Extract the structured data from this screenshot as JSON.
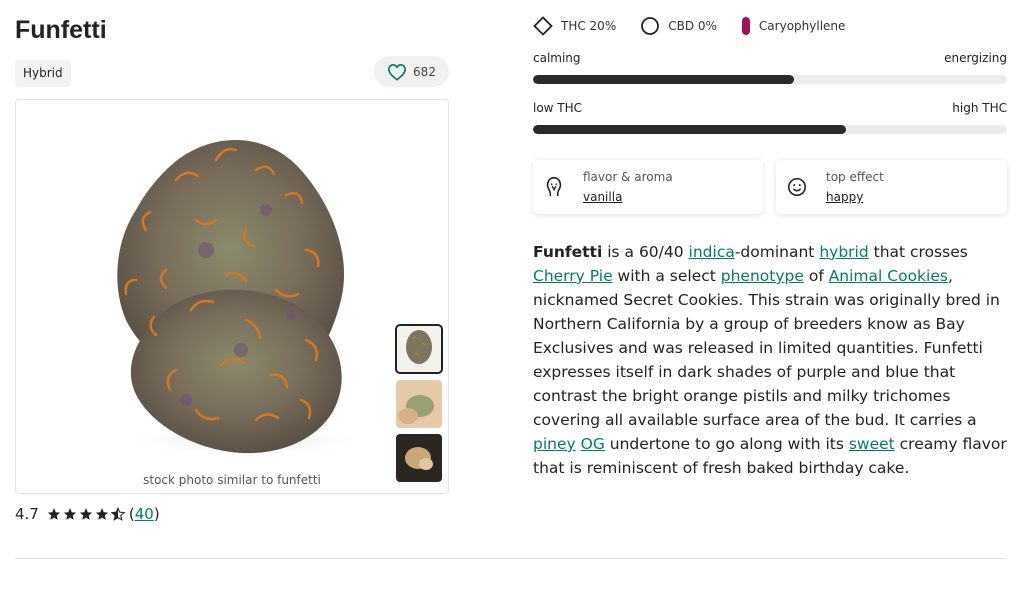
{
  "strain": {
    "name": "Funfetti",
    "type": "Hybrid",
    "favorites_count": "682"
  },
  "photo": {
    "caption": "stock photo similar to funfetti",
    "thumbnails": [
      "thumbnail-1",
      "thumbnail-2",
      "thumbnail-3"
    ],
    "active_thumbnail": 1
  },
  "rating": {
    "score": "4.7",
    "stars_value": 4.7,
    "count_label": "40"
  },
  "chemistry": {
    "thc": "THC 20%",
    "cbd": "CBD 0%",
    "terpene": "Caryophyllene",
    "terpene_color": "#a0105c"
  },
  "scales": [
    {
      "left": "calming",
      "right": "energizing",
      "value_fraction": 0.55
    },
    {
      "left": "low THC",
      "right": "high THC",
      "value_fraction": 0.66
    }
  ],
  "cards": {
    "flavor": {
      "label": "flavor & aroma",
      "value": "vanilla"
    },
    "effect": {
      "label": "top effect",
      "value": "happy"
    }
  },
  "description": {
    "p1": "Funfetti",
    "p2": " is a 60/40 ",
    "link_indica": "indica",
    "p3": "-dominant ",
    "link_hybrid": "hybrid",
    "p4": " that crosses ",
    "link_cherry": "Cherry Pie",
    "p5": " with a select ",
    "link_phenotype": "phenotype",
    "p6": " of ",
    "link_animal": "Animal Cookies",
    "p7": ", nicknamed Secret Cookies. This strain was originally bred in Northern California by a group of breeders know as Bay Exclusives and was released in limited quantities. Funfetti expresses itself in dark shades of purple and blue that contrast the bright orange pistils and milky trichomes covering all available surface area of the bud. It carries a ",
    "link_piney": "piney",
    "p8": " ",
    "link_og": "OG",
    "p9": " undertone to go along with its ",
    "link_sweet": "sweet",
    "p10": " creamy flavor that is reminiscent of fresh baked birthday cake."
  },
  "colors": {
    "accent": "#017c6b",
    "bar": "#2a2a2a",
    "track": "#ececec"
  }
}
